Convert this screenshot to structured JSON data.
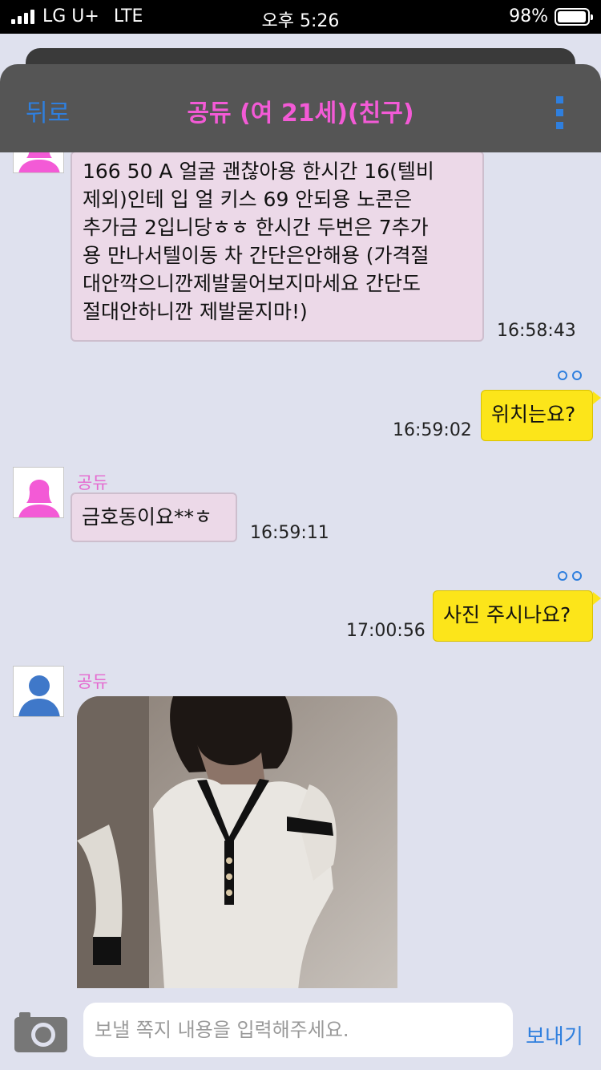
{
  "status_bar": {
    "carrier": "LG U+",
    "network": "LTE",
    "time": "오후 5:26",
    "battery": "98%",
    "battery_level": 0.98
  },
  "nav": {
    "back_label": "뒤로",
    "title": "공듀 (여 21세)(친구)",
    "menu_icon": "vertical-dots-icon"
  },
  "messages": [
    {
      "direction": "in",
      "text": "166 50 A 얼굴 괜찮아용  한시간 16(텔비제외)인테  입 얼 키스 69  안되용 노콘은 추가금 2입니당ㅎㅎ 한시간 두번은 7추가용 만나서텔이동 차 간단은안해용 (가격절대안깍으니깐제발물어보지마세요 간단도 절대안하니깐 제발묻지마!)",
      "lines": [
        "166 50 A 얼굴 괜찮아용  한시간 16(텔비",
        "제외)인테  입 얼 키스 69  안되용 노콘은",
        "추가금 2입니당ㅎㅎ 한시간 두번은 7추가",
        "용 만나서텔이동 차 간단은안해용 (가격절",
        "대안깍으니깐제발물어보지마세요 간단도",
        "절대안하니깐 제발묻지마!)"
      ],
      "time": "16:58:43"
    },
    {
      "direction": "out",
      "text": "위치는요?",
      "time": "16:59:02",
      "read_indicator": "oo"
    },
    {
      "direction": "in",
      "sender": "공듀",
      "text": "금호동이요**ㅎ",
      "time": "16:59:11"
    },
    {
      "direction": "out",
      "text": "사진 주시나요?",
      "time": "17:00:56",
      "read_indicator": "oo"
    },
    {
      "direction": "in",
      "sender": "공듀",
      "type": "photo",
      "photo_description": "woman-in-white-dress-with-black-trim"
    }
  ],
  "input": {
    "placeholder": "보낼 쪽지 내용을 입력해주세요.",
    "value": "",
    "send_label": "보내기",
    "camera_icon": "camera-icon"
  },
  "colors": {
    "background": "#dfe1ee",
    "nav_bar": "#555555",
    "title": "#f35ad6",
    "link": "#2f7fde",
    "incoming_bubble": "#ecd9e8",
    "outgoing_bubble": "#fce51a",
    "sender_name": "#e56ad0"
  }
}
